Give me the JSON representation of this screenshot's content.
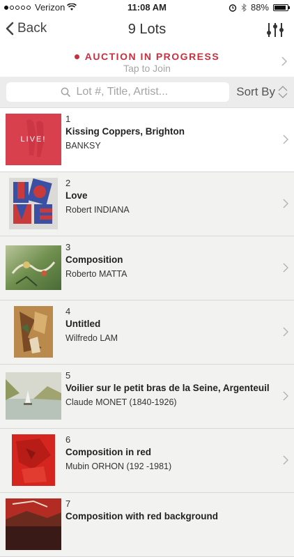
{
  "status_bar": {
    "carrier": "Verizon",
    "time": "11:08 AM",
    "battery": "88%",
    "battery_level": 0.88,
    "icons": [
      "signal-dots",
      "wifi-icon",
      "alarm-icon",
      "bluetooth-icon",
      "battery-icon"
    ]
  },
  "nav": {
    "back_label": "Back",
    "title": "9 Lots",
    "filter_icon": "sliders-icon"
  },
  "banner": {
    "title": "AUCTION IN PROGRESS",
    "subtitle": "Tap to Join",
    "accent": "#c8303f"
  },
  "search": {
    "placeholder": "Lot #, Title, Artist...",
    "sort_label": "Sort By"
  },
  "lots": [
    {
      "number": "1",
      "title": "Kissing Coppers, Brighton",
      "artist": "BANKSY",
      "badge": "LIVE!"
    },
    {
      "number": "2",
      "title": "Love",
      "artist": "Robert INDIANA"
    },
    {
      "number": "3",
      "title": "Composition",
      "artist": "Roberto MATTA"
    },
    {
      "number": "4",
      "title": "Untitled",
      "artist": "Wilfredo LAM"
    },
    {
      "number": "5",
      "title": "Voilier sur le petit bras de la Seine, Argenteuil",
      "artist": "Claude MONET (1840-1926)"
    },
    {
      "number": "6",
      "title": "Composition in red",
      "artist": "Mubin ORHON (192 -1981)"
    },
    {
      "number": "7",
      "title": "Composition with red background",
      "artist": ""
    }
  ]
}
